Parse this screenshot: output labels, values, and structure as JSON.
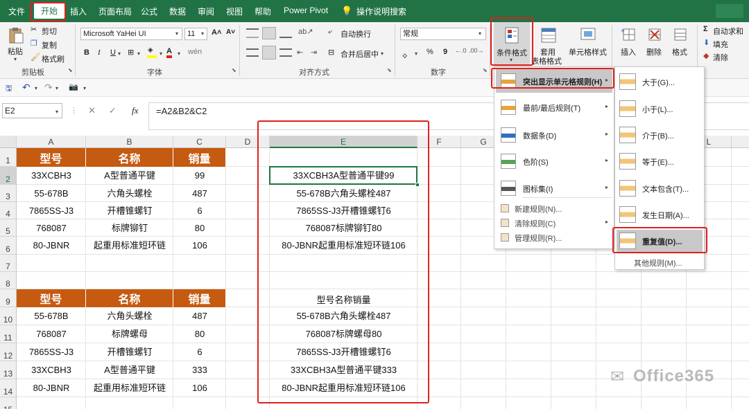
{
  "tabs": [
    "文件",
    "开始",
    "插入",
    "页面布局",
    "公式",
    "数据",
    "审阅",
    "视图",
    "帮助",
    "Power Pivot",
    "操作说明搜索"
  ],
  "clipboard": {
    "paste": "粘贴",
    "cut": "剪切",
    "copy": "复制",
    "painter": "格式刷",
    "group": "剪贴板"
  },
  "font": {
    "name": "Microsoft YaHei UI",
    "size": "11",
    "group": "字体",
    "bold": "B",
    "italic": "I",
    "underline": "U"
  },
  "align": {
    "wrap": "自动换行",
    "merge": "合并后居中",
    "group": "对齐方式"
  },
  "number": {
    "format": "常规",
    "group": "数字",
    "percent": "%",
    "comma": "9"
  },
  "styles": {
    "cond": "条件格式",
    "table_a": "套用",
    "table_b": "表格格式",
    "cell": "单元格样式"
  },
  "cells": {
    "insert": "插入",
    "delete": "删除",
    "format": "格式"
  },
  "editing": {
    "autosum": "自动求和",
    "fill": "填充",
    "clear": "清除"
  },
  "namebox": "E2",
  "formula": "=A2&B2&C2",
  "fx": "fx",
  "columns": [
    "A",
    "B",
    "C",
    "D",
    "E",
    "F",
    "G",
    "H",
    "I",
    "J",
    "K",
    "L",
    "M"
  ],
  "rows": [
    "1",
    "2",
    "3",
    "4",
    "5",
    "6",
    "7",
    "8",
    "9",
    "10",
    "11",
    "12",
    "13",
    "14",
    "15"
  ],
  "table1": {
    "headers": [
      "型号",
      "名称",
      "销量"
    ],
    "rows": [
      [
        "33XCBH3",
        "A型普通平键",
        "99"
      ],
      [
        "55-678B",
        "六角头螺栓",
        "487"
      ],
      [
        "7865SS-J3",
        "开槽锥螺钉",
        "6"
      ],
      [
        "768087",
        "标牌铆钉",
        "80"
      ],
      [
        "80-JBNR",
        "起重用标准短环链",
        "106"
      ]
    ]
  },
  "table2": {
    "headers": [
      "型号",
      "名称",
      "销量"
    ],
    "rows": [
      [
        "55-678B",
        "六角头螺栓",
        "487"
      ],
      [
        "768087",
        "标牌螺母",
        "80"
      ],
      [
        "7865SS-J3",
        "开槽锥螺钉",
        "6"
      ],
      [
        "33XCBH3",
        "A型普通平键",
        "333"
      ],
      [
        "80-JBNR",
        "起重用标准短环链",
        "106"
      ]
    ]
  },
  "colE": {
    "top": [
      "33XCBH3A型普通平键99",
      "55-678B六角头螺栓487",
      "7865SS-J3开槽锥螺钉6",
      "768087标牌铆钉80",
      "80-JBNR起重用标准短环链106"
    ],
    "mid": "型号名称销量",
    "bottom": [
      "55-678B六角头螺栓487",
      "768087标牌螺母80",
      "7865SS-J3开槽锥螺钉6",
      "33XCBH3A型普通平键333",
      "80-JBNR起重用标准短环链106"
    ]
  },
  "menu1": {
    "items": [
      "突出显示单元格规则(H)",
      "最前/最后规则(T)",
      "数据条(D)",
      "色阶(S)",
      "图标集(I)"
    ],
    "small": [
      "新建规则(N)...",
      "清除规则(C)",
      "管理规则(R)..."
    ]
  },
  "menu2": {
    "items": [
      "大于(G)...",
      "小于(L)...",
      "介于(B)...",
      "等于(E)...",
      "文本包含(T)...",
      "发生日期(A)...",
      "重复值(D)..."
    ],
    "more": "其他规则(M)..."
  },
  "watermark": "Office365",
  "colors": {
    "ribbon": "#217346",
    "header_fill": "#c55a11",
    "highlight": "#e0201c"
  }
}
